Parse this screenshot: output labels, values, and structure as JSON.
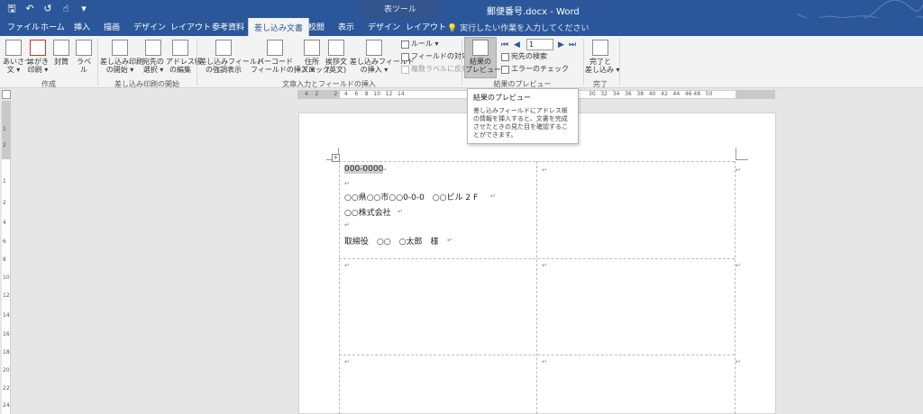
{
  "titlebar": {
    "doc_title": "郵便番号.docx  -  Word",
    "contextual_group": "表ツール",
    "qat": {
      "save": "🖫",
      "undo": "↶",
      "redo": "↺",
      "touch": "☝",
      "more": "▾"
    }
  },
  "tabs": {
    "file": "ファイル",
    "home": "ホーム",
    "insert": "挿入",
    "draw": "描画",
    "design": "デザイン",
    "layout": "レイアウト",
    "references": "参考資料",
    "mailings": "差し込み文書",
    "review": "校閲",
    "view": "表示",
    "table_design": "デザイン",
    "table_layout": "レイアウト",
    "tellme": "実行したい作業を入力してください"
  },
  "ribbon": {
    "create": {
      "label": "作成",
      "envelope_greeting": "あいさつ\n文 ▾",
      "postcard": "はがき\n印刷 ▾",
      "envelope": "封筒",
      "labels": "ラベル"
    },
    "start_merge": {
      "label": "差し込み印刷の開始",
      "start": "差し込み印刷\nの開始 ▾",
      "select_recipients": "宛先の\n選択 ▾",
      "edit_list": "アドレス帳\nの編集"
    },
    "write_insert": {
      "label": "文章入力とフィールドの挿入",
      "highlight_fields": "差し込みフィールド\nの強調表示",
      "barcode": "バーコード\nフィールドの挿入 ▾",
      "address_block": "住所\nブロック",
      "greeting_line": "挨拶文\n(英文)",
      "insert_field": "差し込みフィールド\nの挿入 ▾",
      "rules": "ルール ▾",
      "match_fields": "フィールドの対応",
      "update_labels": "複数ラベルに反映"
    },
    "preview": {
      "label": "結果のプレビュー",
      "preview_results": "結果の\nプレビュー",
      "record_number": "1",
      "find_recipient": "宛先の検索",
      "check_errors": "エラーのチェック"
    },
    "finish": {
      "label": "完了",
      "finish_merge": "完了と\n差し込み ▾"
    }
  },
  "ruler": {
    "h_left": "4    2         2    4    6    8   10   12   14",
    "h_right": "30   32   34   36   38   40   42   44   46 48   50",
    "v_nums": [
      "1",
      "2",
      "1",
      "2",
      "4",
      "6",
      "8",
      "10",
      "12",
      "14",
      "16",
      "18",
      "20",
      "22",
      "24"
    ]
  },
  "tooltip": {
    "title": "結果のプレビュー",
    "body": "差し込みフィールドにアドレス帳の情報を挿入すると、文書を完成させたときの見た目を確認することができます。"
  },
  "document": {
    "label1": {
      "postal": "000-0000",
      "address": "○○県○○市○○0-0-0　○○ビル 2 F",
      "company": "○○株式会社",
      "name": "取締役　○○　○太郎　様"
    },
    "para_mark": "↵"
  }
}
